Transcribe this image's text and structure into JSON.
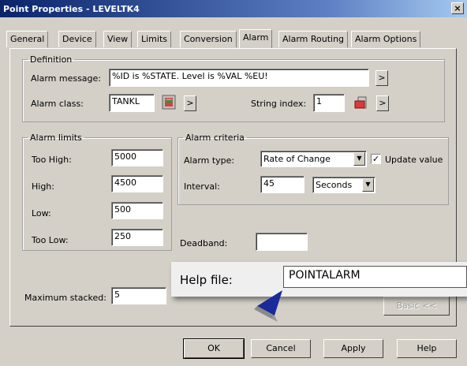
{
  "window": {
    "title": "Point Properties - LEVELTK4",
    "close_glyph": "×"
  },
  "tabs": [
    {
      "label": "General"
    },
    {
      "label": "Device"
    },
    {
      "label": "View"
    },
    {
      "label": "Limits"
    },
    {
      "label": "Conversion"
    },
    {
      "label": "Alarm"
    },
    {
      "label": "Alarm Routing"
    },
    {
      "label": "Alarm Options"
    }
  ],
  "active_tab": "Alarm",
  "definition": {
    "legend": "Definition",
    "alarm_message_label": "Alarm message:",
    "alarm_message_value": "%ID is %STATE. Level is %VAL %EU!",
    "alarm_class_label": "Alarm class:",
    "alarm_class_value": "TANKL",
    "string_index_label": "String index:",
    "string_index_value": "1",
    "more_glyph": ">"
  },
  "alarm_limits": {
    "legend": "Alarm limits",
    "too_high_label": "Too High:",
    "too_high_value": "5000",
    "high_label": "High:",
    "high_value": "4500",
    "low_label": "Low:",
    "low_value": "500",
    "too_low_label": "Too Low:",
    "too_low_value": "250"
  },
  "alarm_criteria": {
    "legend": "Alarm criteria",
    "alarm_type_label": "Alarm type:",
    "alarm_type_value": "Rate of Change",
    "update_value_label": "Update value",
    "update_value_checked": true,
    "interval_label": "Interval:",
    "interval_value": "45",
    "interval_unit": "Seconds"
  },
  "deadband": {
    "label": "Deadband:",
    "value": ""
  },
  "maximum_stacked": {
    "label": "Maximum stacked:",
    "value": "5"
  },
  "callout": {
    "label": "Help file:",
    "value": "POINTALARM"
  },
  "basic_button": "Basic <<",
  "footer": {
    "ok": "OK",
    "cancel": "Cancel",
    "apply": "Apply",
    "help": "Help"
  },
  "colors": {
    "title_start": "#0a246a",
    "title_end": "#a6caf0",
    "face": "#d4d0c8",
    "pointer": "#1a2a9a"
  },
  "icons": {
    "alarm_class_icon": "database-icon",
    "string_index_icon": "string-table-icon",
    "pointer": "arrow-pointer-icon"
  }
}
